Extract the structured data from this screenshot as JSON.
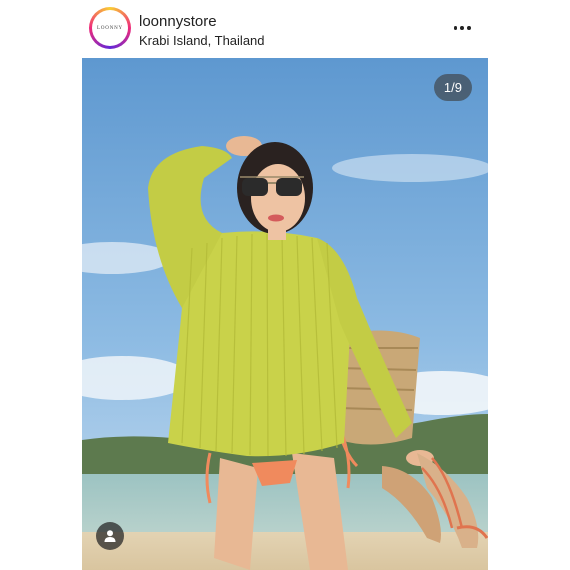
{
  "post": {
    "username": "loonnystore",
    "location": "Krabi Island, Thailand",
    "avatar_logo_text": "LOONNY",
    "carousel_counter": "1/9"
  },
  "icons": {
    "more": "more-options-icon",
    "tag": "person-tag-icon"
  },
  "colors": {
    "sky": "#7fb1df",
    "sweater": "#c9d24a",
    "sea": "#8fb7b8",
    "sand": "#e8d9bc"
  }
}
